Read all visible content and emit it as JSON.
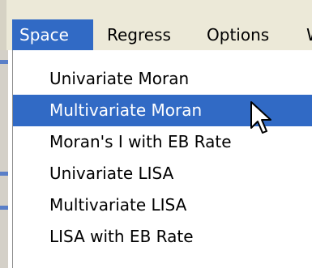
{
  "menubar": {
    "items": [
      "Space",
      "Regress",
      "Options",
      "W"
    ]
  },
  "dropdown": {
    "items": [
      "Univariate Moran",
      "Multivariate Moran",
      "Moran's I with EB Rate",
      "Univariate LISA",
      "Multivariate LISA",
      "LISA with EB Rate"
    ],
    "selected_index": 1
  },
  "colors": {
    "highlight": "#316ac5",
    "menubar_bg": "#ece9d8",
    "menu_bg": "#ffffff"
  },
  "icons": {
    "cursor": "arrow-cursor-icon"
  }
}
